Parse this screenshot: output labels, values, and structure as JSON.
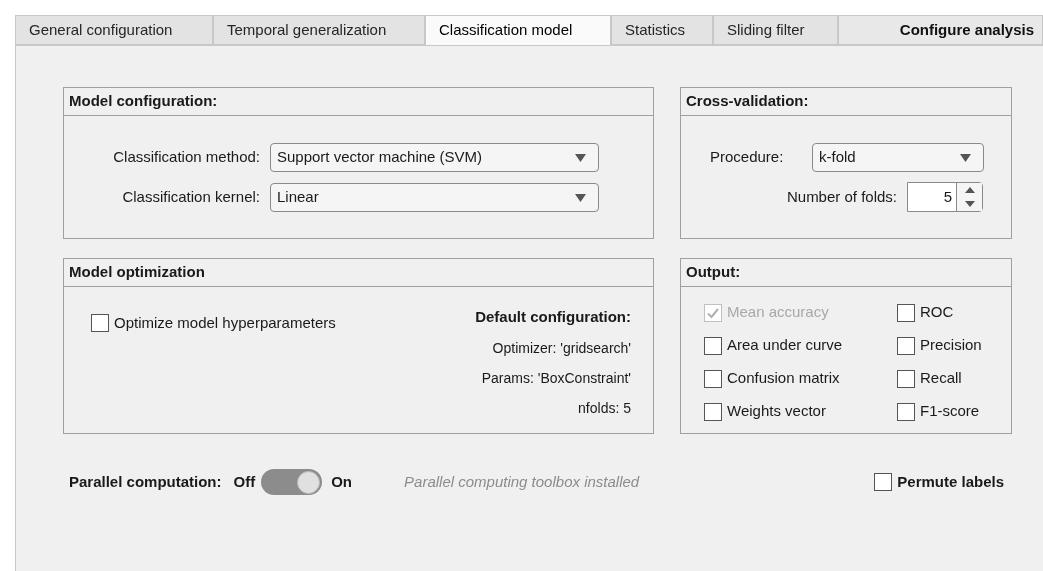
{
  "tabs": [
    {
      "label": "General configuration",
      "selected": false,
      "kind": "tab"
    },
    {
      "label": "Temporal generalization",
      "selected": false,
      "kind": "tab"
    },
    {
      "label": "Classification model",
      "selected": true,
      "kind": "tab"
    },
    {
      "label": "Statistics",
      "selected": false,
      "kind": "tab"
    },
    {
      "label": "Sliding filter",
      "selected": false,
      "kind": "tab"
    },
    {
      "label": "Configure analysis",
      "kind": "action"
    }
  ],
  "model_configuration": {
    "title": "Model configuration:",
    "fields": [
      {
        "label": "Classification method:",
        "value": "Support vector machine (SVM)"
      },
      {
        "label": "Classification kernel:",
        "value": "Linear"
      }
    ]
  },
  "model_optimization": {
    "title": "Model optimization",
    "checkbox": {
      "label": "Optimize model hyperparameters",
      "checked": false
    },
    "defaults": {
      "title": "Default configuration:",
      "lines": [
        "Optimizer: 'gridsearch'",
        "Params: 'BoxConstraint'",
        "nfolds: 5"
      ]
    }
  },
  "cross_validation": {
    "title": "Cross-validation:",
    "procedure": {
      "label": "Procedure:",
      "value": "k-fold"
    },
    "folds": {
      "label": "Number of folds:",
      "value": "5"
    }
  },
  "output": {
    "title": "Output:",
    "options": [
      {
        "label": "Mean accuracy",
        "checked": true,
        "disabled": true
      },
      {
        "label": "ROC",
        "checked": false,
        "disabled": false
      },
      {
        "label": "Area under curve",
        "checked": false,
        "disabled": false
      },
      {
        "label": "Precision",
        "checked": false,
        "disabled": false
      },
      {
        "label": "Confusion matrix",
        "checked": false,
        "disabled": false
      },
      {
        "label": "Recall",
        "checked": false,
        "disabled": false
      },
      {
        "label": "Weights vector",
        "checked": false,
        "disabled": false
      },
      {
        "label": "F1-score",
        "checked": false,
        "disabled": false
      }
    ]
  },
  "parallel": {
    "label": "Parallel computation:",
    "off_label": "Off",
    "on_label": "On",
    "on": true,
    "note": "Parallel computing toolbox installed"
  },
  "permute": {
    "label": "Permute labels",
    "checked": false
  }
}
